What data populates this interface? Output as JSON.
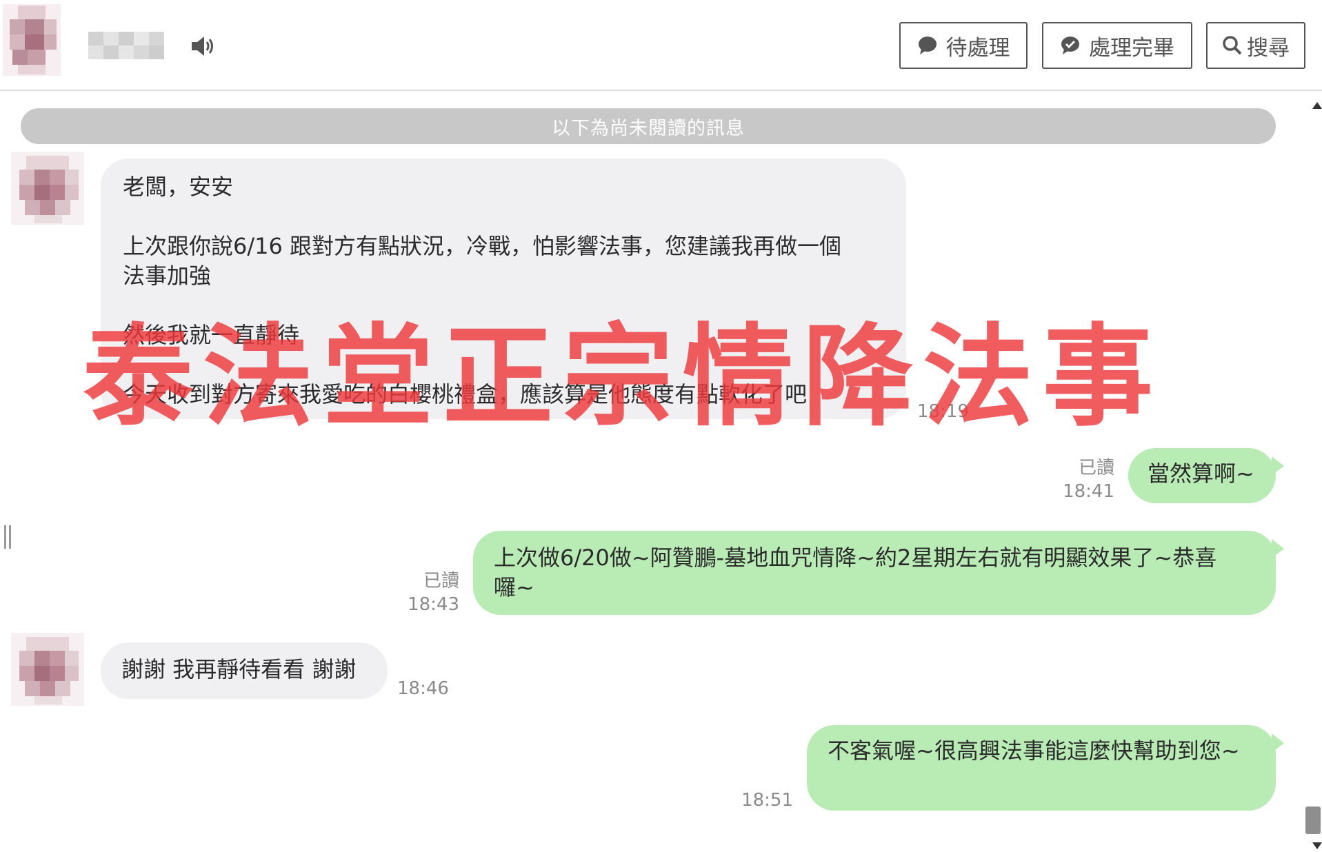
{
  "header": {
    "contact_name": "",
    "buttons": [
      {
        "label": "待處理",
        "icon": "chat-bubble-icon"
      },
      {
        "label": "處理完畢",
        "icon": "chat-check-icon"
      },
      {
        "label": "搜尋",
        "icon": "search-icon"
      }
    ]
  },
  "chat": {
    "unread_divider": "以下為尚未閱讀的訊息",
    "messages": [
      {
        "direction": "incoming",
        "lines": [
          "老闆，安安",
          "",
          "上次跟你說6/16 跟對方有點狀況，冷戰，怕影響法事，您建議我再做一個",
          "法事加強",
          "",
          "然後我就一直靜待",
          "",
          "今天收到對方寄來我愛吃的白櫻桃禮盒，應該算是他態度有點軟化了吧"
        ],
        "time": "18:19"
      },
      {
        "direction": "outgoing",
        "lines": [
          "當然算啊~"
        ],
        "read": "已讀",
        "time": "18:41"
      },
      {
        "direction": "outgoing",
        "lines": [
          "上次做6/20做~阿贊鵬-墓地血咒情降~約2星期左右就有明顯效果了~恭喜",
          "囉~"
        ],
        "read": "已讀",
        "time": "18:43"
      },
      {
        "direction": "incoming",
        "lines": [
          "謝謝 我再靜待看看 謝謝"
        ],
        "time": "18:46"
      },
      {
        "direction": "outgoing",
        "lines": [
          "不客氣喔~很高興法事能這麼快幫助到您~"
        ],
        "time": "18:51"
      }
    ]
  },
  "watermark": "泰法堂正宗情降法事",
  "colors": {
    "incoming_bubble": "#f0f0f3",
    "outgoing_bubble": "#b9ecb5",
    "unread_bar": "#c8c8c8",
    "watermark": "#ee383c"
  }
}
